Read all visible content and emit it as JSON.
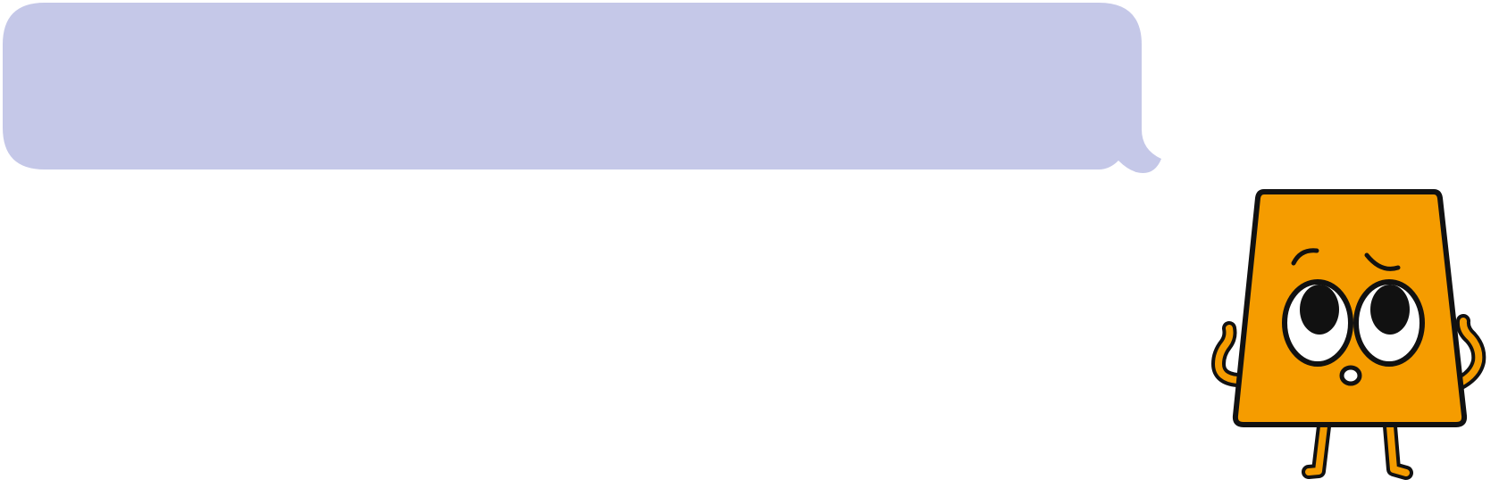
{
  "speech_bubble": {
    "text": "",
    "fill_color": "#c5c8e8"
  },
  "mascot": {
    "icon": "trapezoid-character-icon",
    "body_color": "#f59c00",
    "outline_color": "#111111"
  }
}
